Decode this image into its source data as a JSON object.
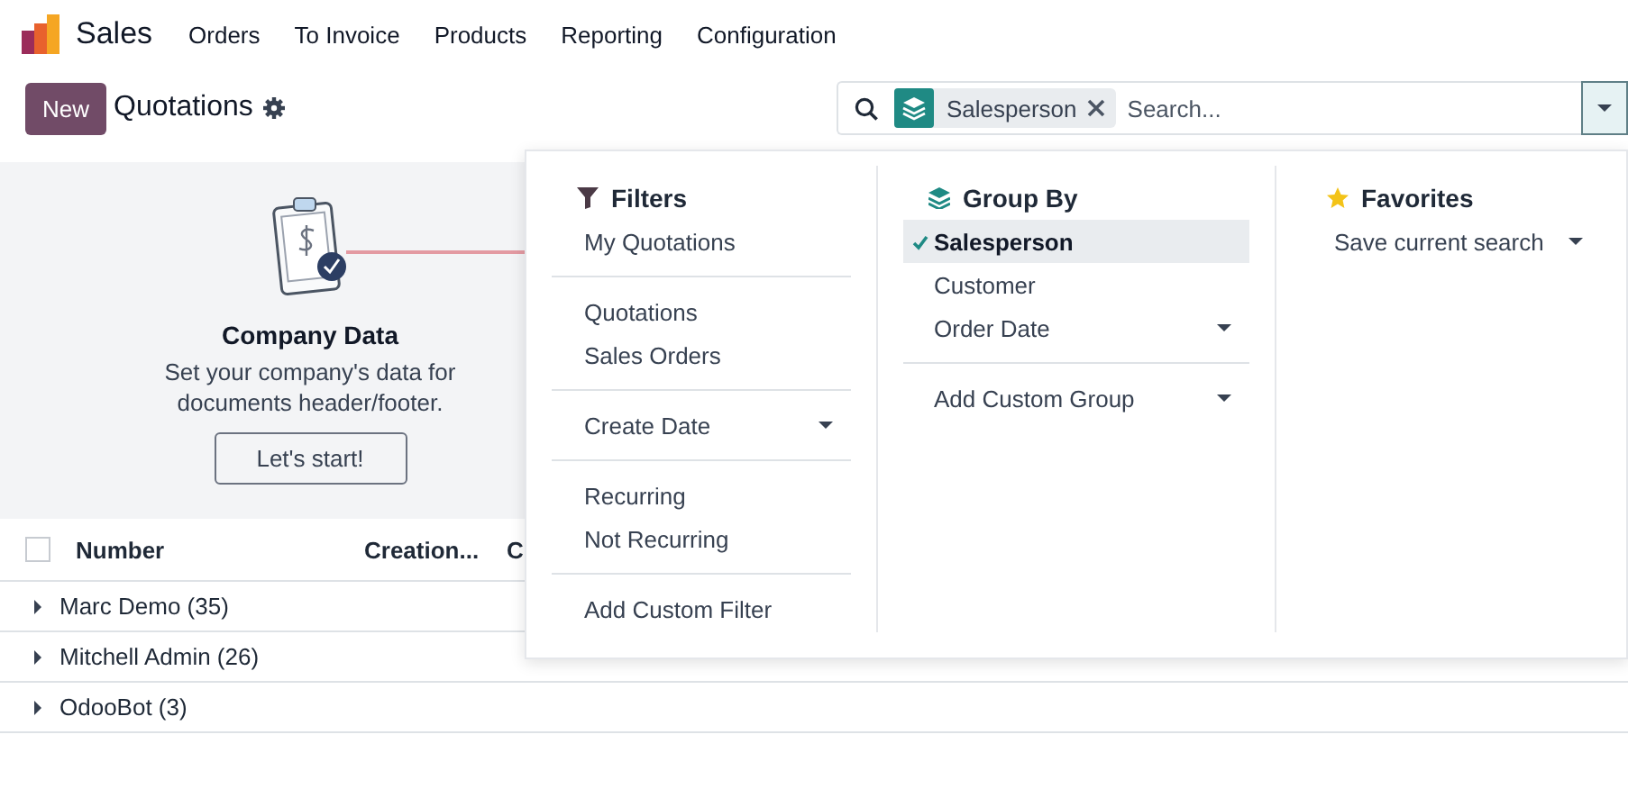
{
  "app": {
    "name": "Sales"
  },
  "menu": [
    {
      "label": "Orders"
    },
    {
      "label": "To Invoice"
    },
    {
      "label": "Products"
    },
    {
      "label": "Reporting"
    },
    {
      "label": "Configuration"
    }
  ],
  "control_panel": {
    "new_button": "New",
    "title": "Quotations"
  },
  "search": {
    "facets": [
      {
        "label": "Salesperson"
      }
    ],
    "placeholder": "Search...",
    "dropdown_open": true
  },
  "onboarding": {
    "title": "Company Data",
    "text": "Set your company's data for documents header/footer.",
    "button": "Let's start!"
  },
  "table": {
    "all_selected": false,
    "columns": [
      {
        "label": "Number"
      },
      {
        "label": "Creation..."
      },
      {
        "label": "C"
      }
    ],
    "groups": [
      {
        "label": "Marc Demo (35)",
        "expanded": false
      },
      {
        "label": "Mitchell Admin (26)",
        "expanded": false
      },
      {
        "label": "OdooBot (3)",
        "expanded": false
      }
    ]
  },
  "filters": {
    "title": "Filters",
    "sections": [
      [
        {
          "label": "My Quotations",
          "selected": false,
          "has_options": false
        }
      ],
      [
        {
          "label": "Quotations",
          "selected": false,
          "has_options": false
        },
        {
          "label": "Sales Orders",
          "selected": false,
          "has_options": false
        }
      ],
      [
        {
          "label": "Create Date",
          "selected": false,
          "has_options": true
        }
      ],
      [
        {
          "label": "Recurring",
          "selected": false,
          "has_options": false
        },
        {
          "label": "Not Recurring",
          "selected": false,
          "has_options": false
        }
      ],
      [
        {
          "label": "Add Custom Filter",
          "selected": false,
          "has_options": false
        }
      ]
    ]
  },
  "group_by": {
    "title": "Group By",
    "sections": [
      [
        {
          "label": "Salesperson",
          "selected": true,
          "has_options": false
        },
        {
          "label": "Customer",
          "selected": false,
          "has_options": false
        },
        {
          "label": "Order Date",
          "selected": false,
          "has_options": true
        }
      ],
      [
        {
          "label": "Add Custom Group",
          "selected": false,
          "has_options": true
        }
      ]
    ]
  },
  "favorites": {
    "title": "Favorites",
    "sections": [
      [
        {
          "label": "Save current search",
          "selected": false,
          "has_options": true
        }
      ]
    ]
  }
}
